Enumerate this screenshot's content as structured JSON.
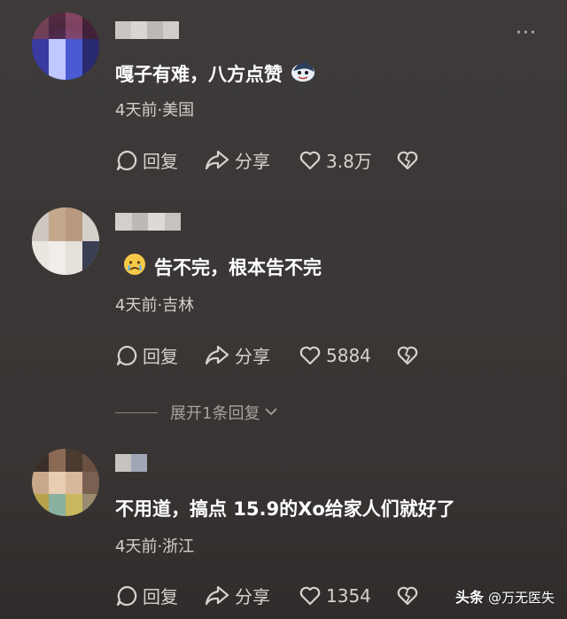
{
  "header": {
    "more_label": "···"
  },
  "comments": [
    {
      "text": "嘎子有难，八方点赞",
      "emoji": "shark-sticker-icon",
      "meta": "4天前·美国",
      "reply_label": "回复",
      "share_label": "分享",
      "likes": "3.8万"
    },
    {
      "text": "告不完，根本告不完",
      "emoji": "crying-face-icon",
      "meta": "4天前·吉林",
      "reply_label": "回复",
      "share_label": "分享",
      "likes": "5884"
    },
    {
      "text": "不用道，搞点 15.9的Xo给家人们就好了",
      "meta": "4天前·浙江",
      "reply_label": "回复",
      "share_label": "分享",
      "likes": "1354"
    }
  ],
  "expand_replies": {
    "label": "展开1条回复"
  },
  "watermark": {
    "brand": "头条",
    "author": "@万无医失"
  },
  "colors": {
    "background": "#3a3736",
    "text_primary": "#ffffff",
    "text_secondary": "#d3cfcb",
    "text_muted": "#a7a29e"
  }
}
